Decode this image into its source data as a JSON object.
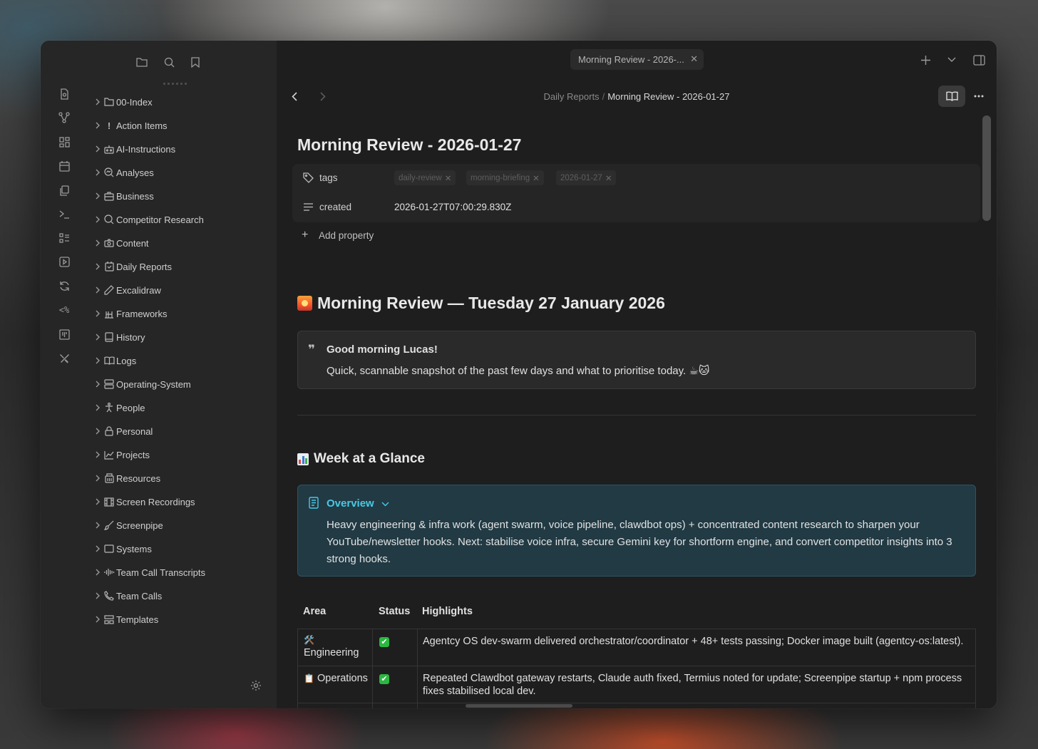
{
  "tab": {
    "title": "Morning Review - 2026-...",
    "close": "✕"
  },
  "breadcrumb": {
    "parent": "Daily Reports",
    "separator": "/",
    "current": "Morning Review - 2026-01-27"
  },
  "sidebar": {
    "items": [
      {
        "label": "00-Index",
        "icon": "folder-icon"
      },
      {
        "label": "Action Items",
        "icon": "exclamation-icon"
      },
      {
        "label": "AI-Instructions",
        "icon": "robot-icon"
      },
      {
        "label": "Analyses",
        "icon": "search-chart-icon"
      },
      {
        "label": "Business",
        "icon": "briefcase-icon"
      },
      {
        "label": "Competitor Research",
        "icon": "search-icon"
      },
      {
        "label": "Content",
        "icon": "camera-icon"
      },
      {
        "label": "Daily Reports",
        "icon": "notepad-icon"
      },
      {
        "label": "Excalidraw",
        "icon": "pencil-icon"
      },
      {
        "label": "Frameworks",
        "icon": "framework-icon"
      },
      {
        "label": "History",
        "icon": "book-icon"
      },
      {
        "label": "Logs",
        "icon": "open-book-icon"
      },
      {
        "label": "Operating-System",
        "icon": "server-icon"
      },
      {
        "label": "People",
        "icon": "person-icon"
      },
      {
        "label": "Personal",
        "icon": "lock-icon"
      },
      {
        "label": "Projects",
        "icon": "line-chart-icon"
      },
      {
        "label": "Resources",
        "icon": "library-icon"
      },
      {
        "label": "Screen Recordings",
        "icon": "film-icon"
      },
      {
        "label": "Screenpipe",
        "icon": "brush-icon"
      },
      {
        "label": "Systems",
        "icon": "window-icon"
      },
      {
        "label": "Team Call Transcripts",
        "icon": "audio-wave-icon"
      },
      {
        "label": "Team Calls",
        "icon": "phone-icon"
      },
      {
        "label": "Templates",
        "icon": "template-icon"
      }
    ]
  },
  "note": {
    "title": "Morning Review - 2026-01-27",
    "properties": {
      "tags_key": "tags",
      "tags": [
        "daily-review",
        "morning-briefing",
        "2026-01-27"
      ],
      "created_key": "created",
      "created_value": "2026-01-27T07:00:29.830Z",
      "add_property": "Add property"
    },
    "heading1": "Morning Review — Tuesday 27 January 2026",
    "quote": {
      "title": "Good morning Lucas!",
      "body": "Quick, scannable snapshot of the past few days and what to prioritise today. ☕🐱"
    },
    "heading2": "Week at a Glance",
    "callout": {
      "title": "Overview",
      "body": "Heavy engineering & infra work (agent swarm, voice pipeline, clawdbot ops) + concentrated content research to sharpen your YouTube/newsletter hooks. Next: stabilise voice infra, secure Gemini key for shortform engine, and convert competitor insights into 3 strong hooks."
    },
    "table": {
      "headers": [
        "Area",
        "Status",
        "Highlights"
      ],
      "rows": [
        {
          "area_emoji": "🛠️",
          "area": "Engineering",
          "status": "✔",
          "highlight": "Agentcy OS dev-swarm delivered orchestrator/coordinator + 48+ tests passing; Docker image built (agentcy-os:latest)."
        },
        {
          "area_emoji": "📋",
          "area": "Operations",
          "status": "✔",
          "highlight": "Repeated Clawdbot gateway restarts, Claude auth fixed, Termius noted for update; Screenpipe startup + npm process fixes stabilised local dev."
        }
      ]
    }
  },
  "colors": {
    "accent_callout": "#4bc8e4",
    "check_green": "#2bb741"
  }
}
